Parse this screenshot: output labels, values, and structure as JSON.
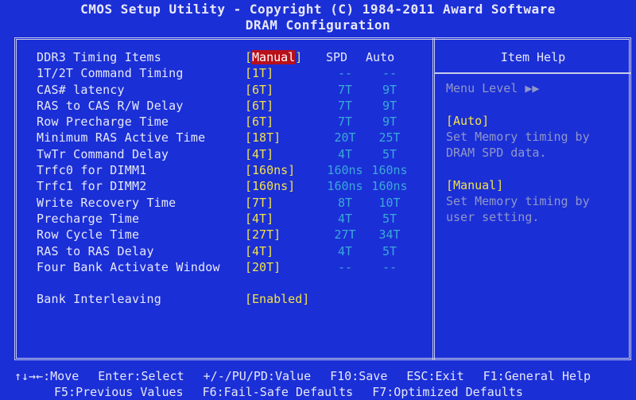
{
  "header": {
    "title": "CMOS Setup Utility - Copyright (C) 1984-2011 Award Software",
    "subtitle": "DRAM Configuration"
  },
  "columns": {
    "spd": "SPD",
    "auto": "Auto"
  },
  "rows": [
    {
      "name": "DDR3 Timing Items",
      "value": "Manual",
      "selected": true,
      "spd": "",
      "auto": ""
    },
    {
      "name": "1T/2T Command Timing",
      "value": "[1T]",
      "spd": "--",
      "auto": "--"
    },
    {
      "name": "CAS# latency",
      "value": "[6T]",
      "spd": "7T",
      "auto": "9T"
    },
    {
      "name": "RAS to CAS R/W Delay",
      "value": "[6T]",
      "spd": "7T",
      "auto": "9T"
    },
    {
      "name": "Row Precharge Time",
      "value": "[6T]",
      "spd": "7T",
      "auto": "9T"
    },
    {
      "name": "Minimum RAS Active Time",
      "value": "[18T]",
      "spd": "20T",
      "auto": "25T"
    },
    {
      "name": "TwTr Command Delay",
      "value": "[4T]",
      "spd": "4T",
      "auto": "5T"
    },
    {
      "name": "Trfc0 for DIMM1",
      "value": "[160ns]",
      "spd": "160ns",
      "auto": "160ns"
    },
    {
      "name": "Trfc1 for DIMM2",
      "value": "[160ns]",
      "spd": "160ns",
      "auto": "160ns"
    },
    {
      "name": "Write Recovery Time",
      "value": "[7T]",
      "spd": "8T",
      "auto": "10T"
    },
    {
      "name": "Precharge Time",
      "value": "[4T]",
      "spd": "4T",
      "auto": "5T"
    },
    {
      "name": "Row Cycle Time",
      "value": "[27T]",
      "spd": "27T",
      "auto": "34T"
    },
    {
      "name": "RAS to RAS Delay",
      "value": "[4T]",
      "spd": "4T",
      "auto": "5T"
    },
    {
      "name": "Four Bank Activate Window",
      "value": "[20T]",
      "spd": "--",
      "auto": "--"
    },
    {
      "name": "",
      "value": "",
      "spd": "",
      "auto": ""
    },
    {
      "name": "Bank Interleaving",
      "value": "[Enabled]",
      "spd": "",
      "auto": ""
    }
  ],
  "help": {
    "title": "Item Help",
    "menu_level": "Menu Level   ▶▶",
    "auto_heading": "[Auto]",
    "auto_line1": "Set Memory timing by",
    "auto_line2": "DRAM SPD data.",
    "manual_heading": "[Manual]",
    "manual_line1": "Set Memory timing by",
    "manual_line2": "user setting."
  },
  "footer": {
    "move": "↑↓→←:Move",
    "select": "Enter:Select",
    "value": "+/-/PU/PD:Value",
    "save": "F10:Save",
    "exit": "ESC:Exit",
    "general_help": "F1:General Help",
    "previous": "F5:Previous Values",
    "failsafe": "F6:Fail-Safe Defaults",
    "optimized": "F7:Optimized Defaults"
  },
  "colors": {
    "background": "#1b2fd6",
    "value": "#f2e24a",
    "highlight": "#b8101a",
    "auto_spd": "#3aa9d8"
  }
}
